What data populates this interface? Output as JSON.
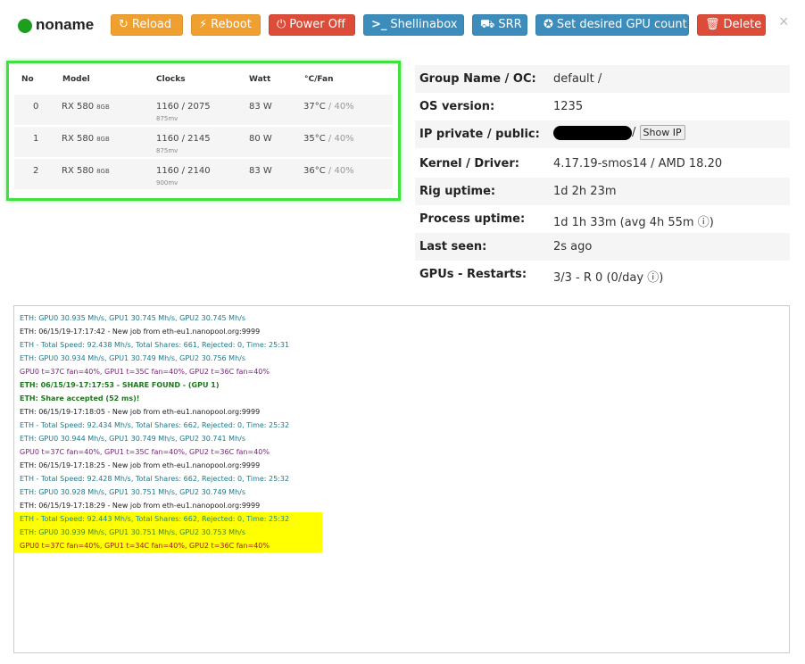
{
  "header": {
    "rig_name": "noname",
    "status_color": "#1e9e1e",
    "buttons": [
      {
        "label": "Reload",
        "icon": "reload-icon",
        "style": "warning"
      },
      {
        "label": "Reboot",
        "icon": "bolt-icon",
        "style": "warning"
      },
      {
        "label": "Power Off",
        "icon": "power-icon",
        "style": "danger"
      },
      {
        "label": "Shellinabox",
        "icon": "terminal-icon",
        "style": "info"
      },
      {
        "label": "SRR",
        "icon": "cart-icon",
        "style": "info"
      },
      {
        "label": "Set desired GPU count",
        "icon": "check-badge-icon",
        "style": "info"
      },
      {
        "label": "Delete",
        "icon": "trash-icon",
        "style": "danger"
      }
    ],
    "close": "×"
  },
  "gpu_table": {
    "columns": {
      "no": "No",
      "model": "Model",
      "clocks": "Clocks",
      "watt": "Watt",
      "temp_fan": "°C/Fan"
    },
    "rows": [
      {
        "no": "0",
        "model": "RX 580",
        "mem": "8GB",
        "clocks": "1160 / 2075",
        "mv": "875mv",
        "watt": "83 W",
        "temp": "37°C",
        "fan": "/ 40%"
      },
      {
        "no": "1",
        "model": "RX 580",
        "mem": "8GB",
        "clocks": "1160 / 2145",
        "mv": "875mv",
        "watt": "80 W",
        "temp": "35°C",
        "fan": "/ 40%"
      },
      {
        "no": "2",
        "model": "RX 580",
        "mem": "8GB",
        "clocks": "1160 / 2140",
        "mv": "900mv",
        "watt": "83 W",
        "temp": "36°C",
        "fan": "/ 40%"
      }
    ]
  },
  "info": {
    "group_label": "Group Name / OC:",
    "group_value": "default /",
    "os_label": "OS version:",
    "os_value": "1235",
    "ip_label": "IP private / public:",
    "ip_sep": "/",
    "show_ip": "Show IP",
    "kernel_label": "Kernel / Driver:",
    "kernel_value": "4.17.19-smos14 / AMD 18.20",
    "uptime_label": "Rig uptime:",
    "uptime_value": "1d 2h 23m",
    "process_label": "Process uptime:",
    "process_value": "1d 1h 33m (avg 4h 55m ⓘ)",
    "seen_label": "Last seen:",
    "seen_value": "2s ago",
    "restarts_label": "GPUs - Restarts:",
    "restarts_value": "3/3 - R 0 (0/day ⓘ)"
  },
  "console": {
    "lines": [
      {
        "text": "ETH: GPU0 30.935 Mh/s, GPU1 30.745 Mh/s, GPU2 30.745 Mh/s",
        "color": "teal"
      },
      {
        "text": "ETH: 06/15/19-17:17:42 - New job from eth-eu1.nanopool.org:9999",
        "color": "black"
      },
      {
        "text": "ETH - Total Speed: 92.438 Mh/s, Total Shares: 661, Rejected: 0, Time: 25:31",
        "color": "teal"
      },
      {
        "text": "ETH: GPU0 30.934 Mh/s, GPU1 30.749 Mh/s, GPU2 30.756 Mh/s",
        "color": "teal"
      },
      {
        "text": "GPU0 t=37C fan=40%, GPU1 t=35C fan=40%, GPU2 t=36C fan=40%",
        "color": "purple"
      },
      {
        "text": "ETH: 06/15/19-17:17:53 - SHARE FOUND - (GPU 1)",
        "color": "green"
      },
      {
        "text": "ETH: Share accepted (52 ms)!",
        "color": "green"
      },
      {
        "text": "ETH: 06/15/19-17:18:05 - New job from eth-eu1.nanopool.org:9999",
        "color": "black"
      },
      {
        "text": "ETH - Total Speed: 92.434 Mh/s, Total Shares: 662, Rejected: 0, Time: 25:32",
        "color": "teal"
      },
      {
        "text": "ETH: GPU0 30.944 Mh/s, GPU1 30.749 Mh/s, GPU2 30.741 Mh/s",
        "color": "teal"
      },
      {
        "text": "GPU0 t=37C fan=40%, GPU1 t=35C fan=40%, GPU2 t=36C fan=40%",
        "color": "purple"
      },
      {
        "text": "ETH: 06/15/19-17:18:25 - New job from eth-eu1.nanopool.org:9999",
        "color": "black"
      },
      {
        "text": "ETH - Total Speed: 92.428 Mh/s, Total Shares: 662, Rejected: 0, Time: 25:32",
        "color": "teal"
      },
      {
        "text": "ETH: GPU0 30.928 Mh/s, GPU1 30.751 Mh/s, GPU2 30.749 Mh/s",
        "color": "teal"
      },
      {
        "text": "ETH: 06/15/19-17:18:29 - New job from eth-eu1.nanopool.org:9999",
        "color": "black"
      },
      {
        "text": "ETH - Total Speed: 92.443 Mh/s, Total Shares: 662, Rejected: 0, Time: 25:32",
        "color": "tealhl"
      },
      {
        "text": "ETH: GPU0 30.939 Mh/s, GPU1 30.751 Mh/s, GPU2 30.753 Mh/s",
        "color": "greenhl"
      },
      {
        "text": "GPU0 t=37C fan=40%, GPU1 t=34C fan=40%, GPU2 t=36C fan=40%",
        "color": "redhl"
      }
    ]
  },
  "colors": {
    "warning": "#f0a030",
    "danger": "#dd4b39",
    "info": "#3c8dbc",
    "highlight_box": "#3fe03f",
    "log_highlight": "#ffff00"
  }
}
